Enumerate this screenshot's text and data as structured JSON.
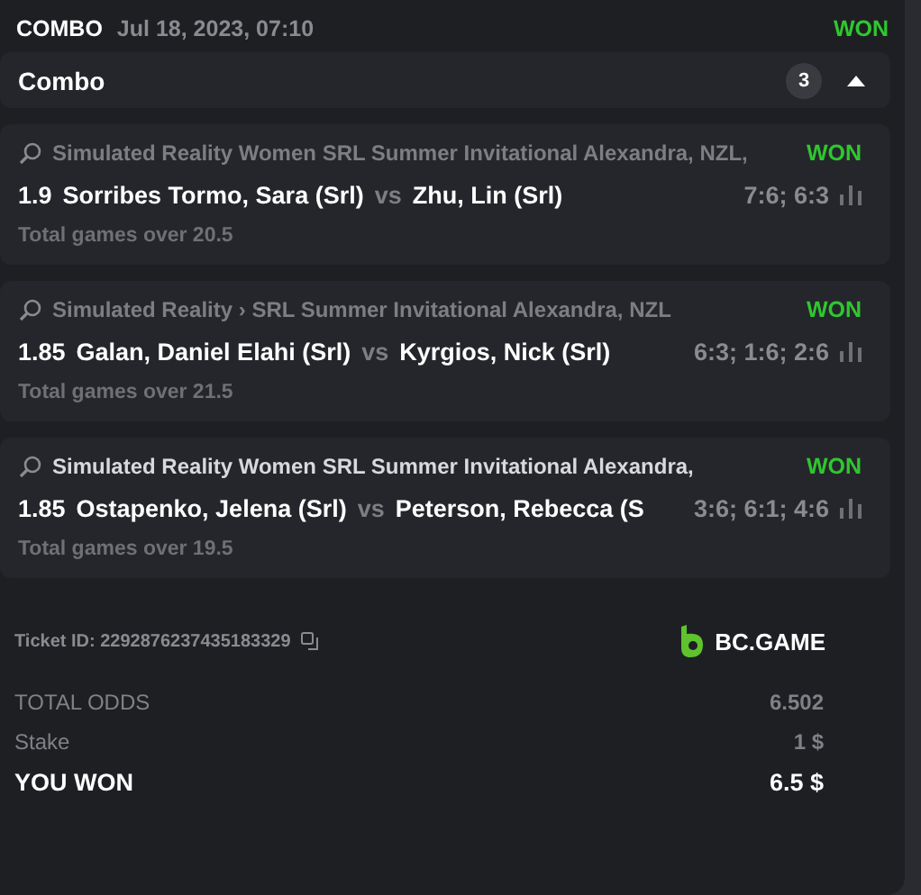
{
  "header": {
    "type": "COMBO",
    "date": "Jul 18, 2023, 07:10",
    "status": "WON"
  },
  "combo": {
    "title": "Combo",
    "count": "3",
    "expanded": true
  },
  "legs": [
    {
      "league": "Simulated Reality Women SRL Summer Invitational Alexandra, NZL,",
      "highlighted": false,
      "status": "WON",
      "odds": "1.9",
      "home": "Sorribes Tormo, Sara (Srl)",
      "vs": "vs",
      "away": "Zhu, Lin (Srl)",
      "score": "7:6; 6:3",
      "market": "Total games over 20.5"
    },
    {
      "league": "Simulated Reality › SRL Summer Invitational Alexandra, NZL",
      "highlighted": false,
      "status": "WON",
      "odds": "1.85",
      "home": "Galan, Daniel Elahi (Srl)",
      "vs": "vs",
      "away": "Kyrgios, Nick (Srl)",
      "score": "6:3; 1:6; 2:6",
      "market": "Total games over 21.5"
    },
    {
      "league": "Simulated Reality Women SRL Summer Invitational Alexandra,",
      "highlighted": true,
      "status": "WON",
      "odds": "1.85",
      "home": "Ostapenko, Jelena (Srl)",
      "vs": "vs",
      "away": "Peterson, Rebecca (S",
      "score": "3:6; 6:1; 4:6",
      "market": "Total games over 19.5"
    }
  ],
  "ticket": {
    "label": "Ticket ID: 2292876237435183329",
    "brand": "BC.GAME"
  },
  "summary": [
    {
      "kind": "muted",
      "label": "TOTAL ODDS",
      "value": "6.502"
    },
    {
      "kind": "muted",
      "label": "Stake",
      "value": "1 $"
    },
    {
      "kind": "total",
      "label": "YOU WON",
      "value": "6.5 $"
    }
  ]
}
